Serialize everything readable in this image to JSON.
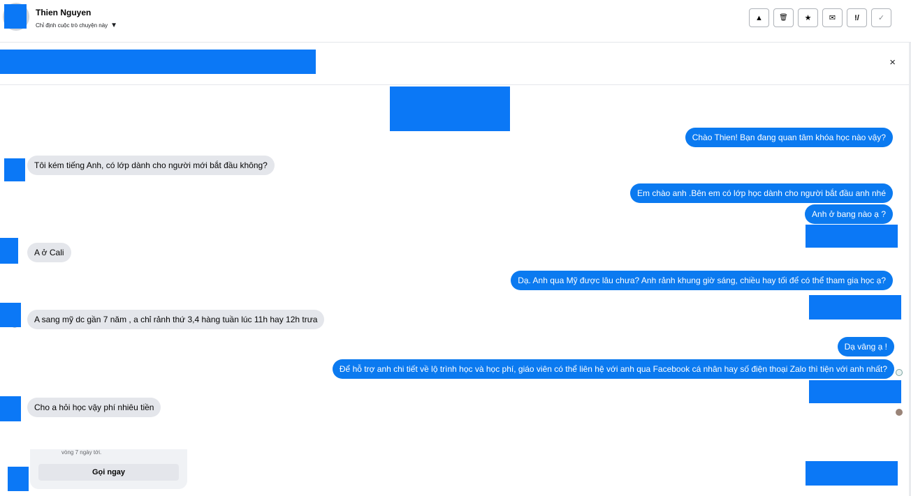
{
  "header": {
    "contact_name": "Thien Nguyen",
    "assign_label": "Chỉ định cuộc trò chuyện này",
    "caret_icon": "caret-down-icon",
    "tools": [
      {
        "icon": "warning-icon",
        "glyph": "▲"
      },
      {
        "icon": "trash-icon",
        "glyph": "🗑"
      },
      {
        "icon": "star-icon",
        "glyph": "★"
      },
      {
        "icon": "envelope-icon",
        "glyph": "✉"
      },
      {
        "icon": "follow-up-icon",
        "glyph": "!/"
      },
      {
        "icon": "check-icon",
        "glyph": "✓"
      }
    ]
  },
  "banner": {
    "close_glyph": "×"
  },
  "messages": [
    {
      "dir": "out",
      "text": "Chào Thien! Bạn đang quan tâm khóa học nào vậy?"
    },
    {
      "dir": "in",
      "text": "Tôi kém tiếng Anh, có lớp dành cho người mới bắt đầu không?"
    },
    {
      "dir": "out",
      "text": "Em chào anh .Bên em có lớp học dành cho người bắt đầu anh nhé"
    },
    {
      "dir": "out",
      "text": "Anh ở bang nào ạ ?"
    },
    {
      "dir": "in",
      "text": "A ở Cali"
    },
    {
      "dir": "out",
      "text": "Dạ. Anh qua Mỹ được lâu chưa? Anh rảnh khung giờ sáng, chiều hay tối để có thể tham gia học ạ?"
    },
    {
      "dir": "in",
      "text": "A sang mỹ dc gần 7 năm , a chỉ rảnh thứ 3,4 hàng tuần lúc 11h hay 12h trưa"
    },
    {
      "dir": "out",
      "text": "Dạ vâng ạ !"
    },
    {
      "dir": "out",
      "text": "Để hỗ trợ anh chi tiết về lộ trình học và học phí, giáo viên có thể liên hệ với anh qua Facebook cá nhân hay số điện thoại Zalo thì tiện với anh  nhất?"
    },
    {
      "dir": "in",
      "text": "Cho a hỏi học vậy phí nhiêu tiền"
    }
  ],
  "call_card": {
    "text": "vòng 7 ngày tới.",
    "button_label": "Gọi ngay"
  },
  "colors": {
    "accent": "#0b7af0",
    "redaction": "#0b78f6",
    "incoming_bubble": "#e4e6eb"
  }
}
